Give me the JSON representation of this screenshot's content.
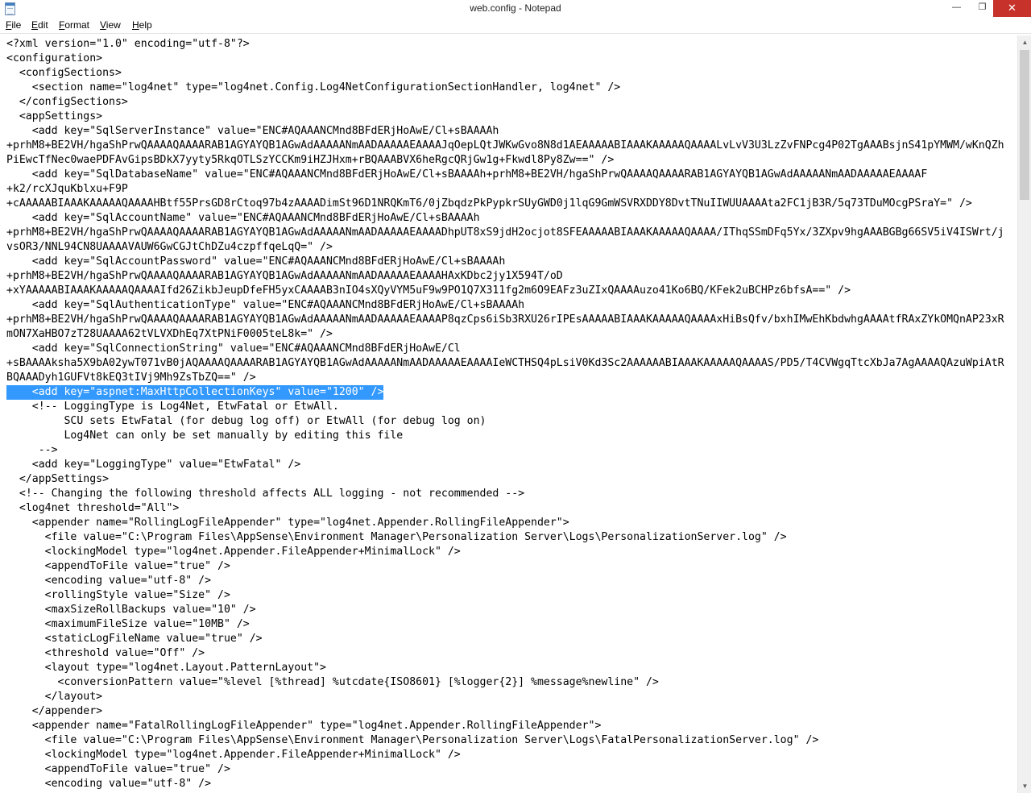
{
  "window": {
    "title": "web.config - Notepad",
    "controls": {
      "minimize": "—",
      "maximize": "❐",
      "close": "✕"
    }
  },
  "menu": [
    {
      "accel": "F",
      "rest": "ile"
    },
    {
      "accel": "E",
      "rest": "dit"
    },
    {
      "accel": "F",
      "rest": "ormat"
    },
    {
      "accel": "V",
      "rest": "iew"
    },
    {
      "accel": "H",
      "rest": "elp"
    }
  ],
  "editor": {
    "selected_line_index": 24,
    "selection_color": "#3399ff",
    "lines": [
      "<?xml version=\"1.0\" encoding=\"utf-8\"?>",
      "<configuration>",
      "  <configSections>",
      "    <section name=\"log4net\" type=\"log4net.Config.Log4NetConfigurationSectionHandler, log4net\" />",
      "  </configSections>",
      "  <appSettings>",
      "    <add key=\"SqlServerInstance\" value=\"ENC#AQAAANCMnd8BFdERjHoAwE/Cl+sBAAAAh",
      "+prhM8+BE2VH/hgaShPrwQAAAAQAAAARAB1AGYAYQB1AGwAdAAAAANmAADAAAAAEAAAAJqOepLQtJWKwGvo8N8d1AEAAAAABIAAAKAAAAAQAAAALvLvV3U3LzZvFNPcg4P02TgAAABsjnS41pYMWM/wKnQZh",
      "PiEwcTfNec0waePDFAvGipsBDkX7yyty5RkqOTLSzYCCKm9iHZJHxm+rBQAAABVX6heRgcQRjGw1g+Fkwdl8Py8Zw==\" />",
      "    <add key=\"SqlDatabaseName\" value=\"ENC#AQAAANCMnd8BFdERjHoAwE/Cl+sBAAAAh+prhM8+BE2VH/hgaShPrwQAAAAQAAAARAB1AGYAYQB1AGwAdAAAAANmAADAAAAAEAAAAF",
      "+k2/rcXJquKblxu+F9P",
      "+cAAAAABIAAAKAAAAAQAAAAHBtf55PrsGD8rCtoq97b4zAAAADimSt96D1NRQKmT6/0jZbqdzPkPypkrSUyGWD0j1lqG9GmWSVRXDDY8DvtTNuIIWUUAAAAta2FC1jB3R/5q73TDuMOcgPSraY=\" />",
      "    <add key=\"SqlAccountName\" value=\"ENC#AQAAANCMnd8BFdERjHoAwE/Cl+sBAAAAh",
      "+prhM8+BE2VH/hgaShPrwQAAAAQAAAARAB1AGYAYQB1AGwAdAAAAANmAADAAAAAEAAAADhpUT8xS9jdH2ocjot8SFEAAAAABIAAAKAAAAAQAAAA/IThqSSmDFq5Yx/3ZXpv9hgAAABGBg66SV5iV4ISWrt/j",
      "vsOR3/NNL94CN8UAAAAVAUW6GwCGJtChDZu4czpffqeLqQ=\" />",
      "    <add key=\"SqlAccountPassword\" value=\"ENC#AQAAANCMnd8BFdERjHoAwE/Cl+sBAAAAh",
      "+prhM8+BE2VH/hgaShPrwQAAAAQAAAARAB1AGYAYQB1AGwAdAAAAANmAADAAAAAEAAAAHAxKDbc2jy1X594T/oD",
      "+xYAAAAABIAAAKAAAAAQAAAAIfd26ZikbJeupDfeFH5yxCAAAAB3nIO4sXQyVYM5uF9w9PO1Q7X311fg2m6O9EAFz3uZIxQAAAAuzo41Ko6BQ/KFek2uBCHPz6bfsA==\" />",
      "    <add key=\"SqlAuthenticationType\" value=\"ENC#AQAAANCMnd8BFdERjHoAwE/Cl+sBAAAAh",
      "+prhM8+BE2VH/hgaShPrwQAAAAQAAAARAB1AGYAYQB1AGwAdAAAAANmAADAAAAAEAAAAP8qzCps6iSb3RXU26rIPEsAAAAABIAAAKAAAAAQAAAAxHiBsQfv/bxhIMwEhKbdwhgAAAAtfRAxZYkOMQnAP23xR",
      "mON7XaHBO7zT28UAAAA62tVLVXDhEq7XtPNiF0005teL8k=\" />",
      "    <add key=\"SqlConnectionString\" value=\"ENC#AQAAANCMnd8BFdERjHoAwE/Cl",
      "+sBAAAAksha5X9bA02ywT071vB0jAQAAAAQAAAARAB1AGYAYQB1AGwAdAAAAANmAADAAAAAEAAAAIeWCTHSQ4pLsiV0Kd3Sc2AAAAAABIAAAKAAAAAQAAAAS/PD5/T4CVWgqTtcXbJa7AgAAAAQAzuWpiAtR",
      "BQAAADyh1GUFVt8kEQ3tIVj9Mh9ZsTbZQ==\" />",
      "    <add key=\"aspnet:MaxHttpCollectionKeys\" value=\"1200\" />",
      "    <!-- LoggingType is Log4Net, EtwFatal or EtwAll.",
      "         SCU sets EtwFatal (for debug log off) or EtwAll (for debug log on)",
      "         Log4Net can only be set manually by editing this file",
      "     -->",
      "    <add key=\"LoggingType\" value=\"EtwFatal\" />",
      "  </appSettings>",
      "  <!-- Changing the following threshold affects ALL logging - not recommended -->",
      "  <log4net threshold=\"All\">",
      "    <appender name=\"RollingLogFileAppender\" type=\"log4net.Appender.RollingFileAppender\">",
      "      <file value=\"C:\\Program Files\\AppSense\\Environment Manager\\Personalization Server\\Logs\\PersonalizationServer.log\" />",
      "      <lockingModel type=\"log4net.Appender.FileAppender+MinimalLock\" />",
      "      <appendToFile value=\"true\" />",
      "      <encoding value=\"utf-8\" />",
      "      <rollingStyle value=\"Size\" />",
      "      <maxSizeRollBackups value=\"10\" />",
      "      <maximumFileSize value=\"10MB\" />",
      "      <staticLogFileName value=\"true\" />",
      "      <threshold value=\"Off\" />",
      "      <layout type=\"log4net.Layout.PatternLayout\">",
      "        <conversionPattern value=\"%level [%thread] %utcdate{ISO8601} [%logger{2}] %message%newline\" />",
      "      </layout>",
      "    </appender>",
      "    <appender name=\"FatalRollingLogFileAppender\" type=\"log4net.Appender.RollingFileAppender\">",
      "      <file value=\"C:\\Program Files\\AppSense\\Environment Manager\\Personalization Server\\Logs\\FatalPersonalizationServer.log\" />",
      "      <lockingModel type=\"log4net.Appender.FileAppender+MinimalLock\" />",
      "      <appendToFile value=\"true\" />",
      "      <encoding value=\"utf-8\" />"
    ]
  },
  "scrollbar": {
    "up_arrow": "▲",
    "down_arrow": "▼"
  }
}
